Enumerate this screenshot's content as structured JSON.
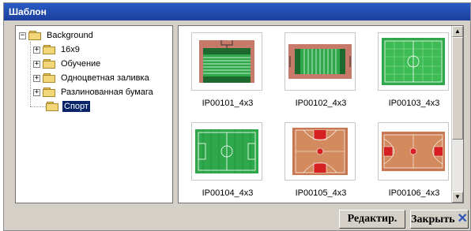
{
  "window": {
    "title": "Шаблон"
  },
  "tree": {
    "root": "Background",
    "items": [
      {
        "label": "16x9",
        "expandable": true
      },
      {
        "label": "Обучение",
        "expandable": true
      },
      {
        "label": "Одноцветная заливка",
        "expandable": true
      },
      {
        "label": "Разлинованная бумага",
        "expandable": true
      },
      {
        "label": "Спорт",
        "expandable": false,
        "selected": true
      }
    ]
  },
  "gallery": {
    "items": [
      {
        "label": "IP00101_4x3",
        "icon": "american-football-field-icon"
      },
      {
        "label": "IP00102_4x3",
        "icon": "football-field-horizontal-icon"
      },
      {
        "label": "IP00103_4x3",
        "icon": "soccer-field-green-icon"
      },
      {
        "label": "IP00104_4x3",
        "icon": "soccer-field-icon"
      },
      {
        "label": "IP00105_4x3",
        "icon": "basketball-court-vertical-icon"
      },
      {
        "label": "IP00106_4x3",
        "icon": "basketball-court-horizontal-icon"
      }
    ]
  },
  "buttons": {
    "edit": "Редактир.",
    "close": "Закрыть"
  },
  "colors": {
    "titlebar": "#2a5cc4",
    "selection": "#0a246a",
    "field_green": "#2ea84a",
    "court_wood": "#c87850",
    "court_red": "#d42020"
  }
}
